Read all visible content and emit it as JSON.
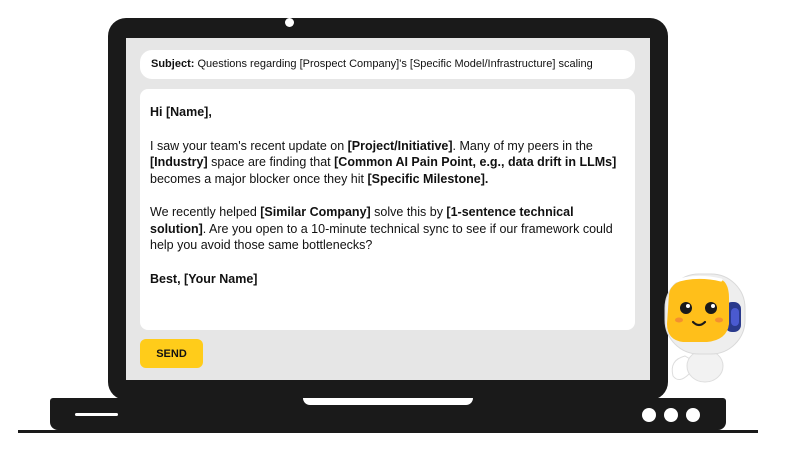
{
  "email": {
    "subject_label": "Subject:",
    "subject_text": "Questions regarding [Prospect Company]'s [Specific Model/Infrastructure] scaling",
    "greeting": "Hi [Name],",
    "p1": {
      "t1": "I saw your team's recent update on ",
      "b1": "[Project/Initiative]",
      "t2": ". Many of my peers in the ",
      "b2": "[Industry]",
      "t3": " space are finding that ",
      "b3": "[Common AI Pain Point, e.g., data drift in LLMs]",
      "t4": " becomes a major blocker once they hit ",
      "b4": "[Specific Milestone]."
    },
    "p2": {
      "t1": "We recently helped ",
      "b1": "[Similar Company]",
      "t2": " solve this by ",
      "b2": "[1-sentence technical solution]",
      "t3": ". Are you open to a 10-minute technical sync to see if our framework could help you avoid those same bottlenecks?"
    },
    "signoff": "Best, [Your Name]"
  },
  "send_button": {
    "label": "SEND"
  },
  "colors": {
    "accent": "#ffcc1a",
    "device": "#1a1a1a",
    "screen_bg": "#e6e6e6"
  },
  "icons": [
    "camera-icon",
    "robot-mascot-icon"
  ]
}
